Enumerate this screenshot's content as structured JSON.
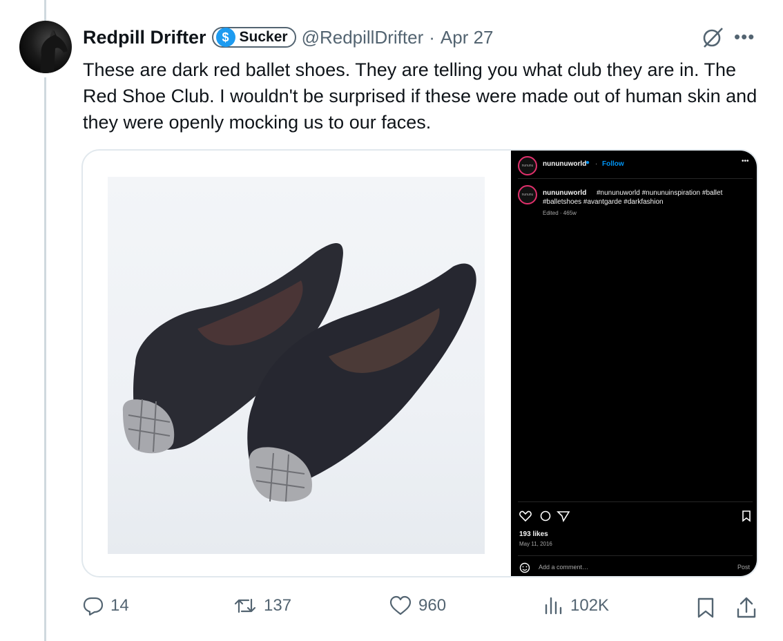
{
  "author": {
    "name": "Redpill Drifter",
    "badge_label": "Sucker",
    "badge_icon": "dollar-icon",
    "handle": "@RedpillDrifter",
    "separator": "·",
    "date": "Apr 27"
  },
  "tweet": {
    "text": "These are dark red ballet shoes. They are telling you what club they are in. The Red Shoe Club. I wouldn't be surprised if these were made out of human skin and they were openly mocking us to our faces."
  },
  "embed": {
    "username": "nununuworld",
    "avatar_text": "nununu",
    "follow_label": "Follow",
    "caption_hashtags": "#nununuworld #nununuinspiration #ballet",
    "caption_hashtags_2": "#balletshoes #avantgarde #darkfashion",
    "edited": "Edited · 465w",
    "likes": "193 likes",
    "post_date": "May 11, 2016",
    "comment_placeholder": "Add a comment…",
    "post_label": "Post"
  },
  "actions": {
    "replies": "14",
    "reposts": "137",
    "likes": "960",
    "views": "102K"
  },
  "colors": {
    "muted": "#536471",
    "accent": "#1d9bf0",
    "border": "#cfd9de"
  }
}
